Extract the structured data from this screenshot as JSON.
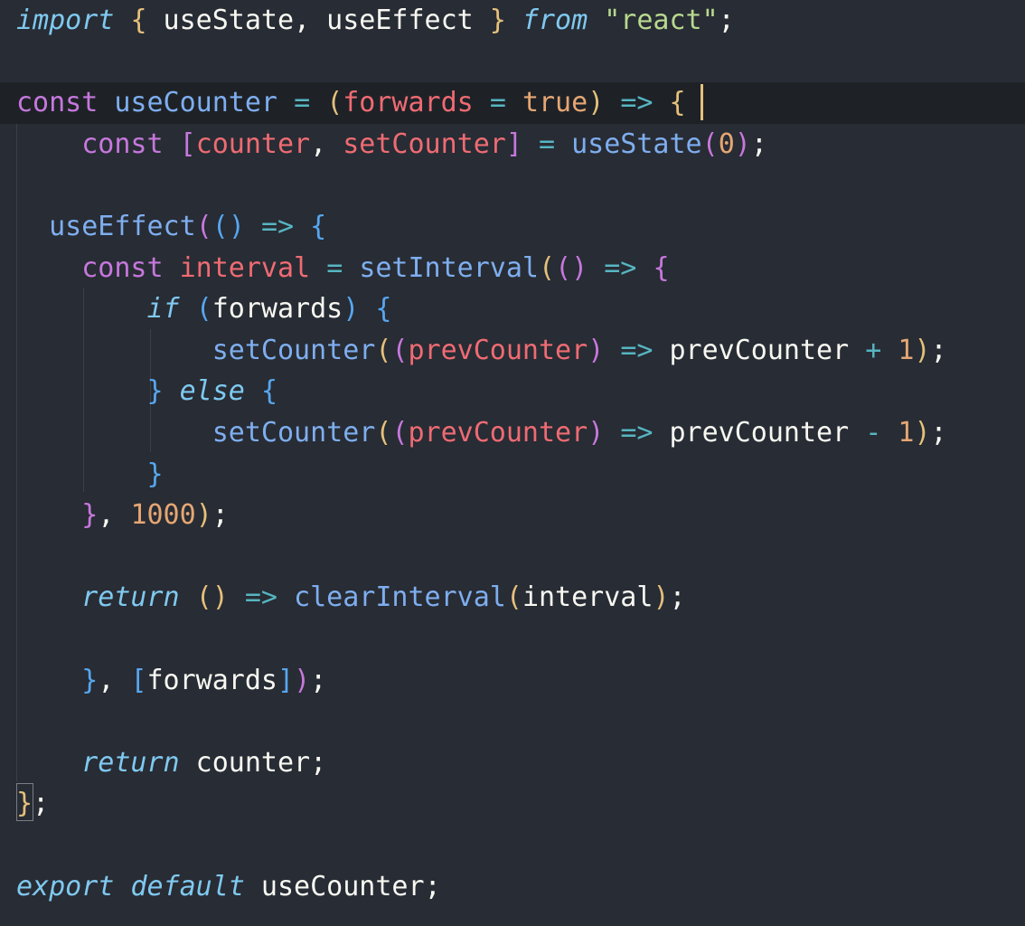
{
  "editor": {
    "language": "javascript",
    "current_line_index": 2,
    "colors": {
      "background": "#282c34",
      "current_line": "#1e2227",
      "keyword": "#c678dd",
      "italic_keyword": "#7fc9f0",
      "function": "#7eaeef",
      "parameter": "#ef6b73",
      "number": "#e5a673",
      "string": "#b8d98f",
      "bracket_level_1": "#e5c07b",
      "bracket_level_2": "#c678dd",
      "bracket_level_3": "#56a7f0"
    },
    "lines": [
      [
        [
          "kwi",
          "import"
        ],
        [
          "pl",
          " "
        ],
        [
          "b1",
          "{"
        ],
        [
          "pl",
          " useState, useEffect "
        ],
        [
          "b1",
          "}"
        ],
        [
          "pl",
          " "
        ],
        [
          "kwi",
          "from"
        ],
        [
          "pl",
          " "
        ],
        [
          "str",
          "\"react\""
        ],
        [
          "sem",
          ";"
        ]
      ],
      [],
      [
        [
          "kw",
          "const"
        ],
        [
          "pl",
          " "
        ],
        [
          "fn",
          "useCounter"
        ],
        [
          "pl",
          " "
        ],
        [
          "op",
          "="
        ],
        [
          "pl",
          " "
        ],
        [
          "b1",
          "("
        ],
        [
          "prm",
          "forwards"
        ],
        [
          "pl",
          " "
        ],
        [
          "op",
          "="
        ],
        [
          "pl",
          " "
        ],
        [
          "num",
          "true"
        ],
        [
          "b1",
          ")"
        ],
        [
          "pl",
          " "
        ],
        [
          "op",
          "=>"
        ],
        [
          "pl",
          " "
        ],
        [
          "b1",
          "{"
        ]
      ],
      [
        [
          "pl",
          "    "
        ],
        [
          "kw",
          "const"
        ],
        [
          "pl",
          " "
        ],
        [
          "b2",
          "["
        ],
        [
          "prm",
          "counter"
        ],
        [
          "pl",
          ", "
        ],
        [
          "prm",
          "setCounter"
        ],
        [
          "b2",
          "]"
        ],
        [
          "pl",
          " "
        ],
        [
          "op",
          "="
        ],
        [
          "pl",
          " "
        ],
        [
          "fn",
          "useState"
        ],
        [
          "b2",
          "("
        ],
        [
          "num",
          "0"
        ],
        [
          "b2",
          ")"
        ],
        [
          "sem",
          ";"
        ]
      ],
      [],
      [
        [
          "pl",
          "  "
        ],
        [
          "fn",
          "useEffect"
        ],
        [
          "b2",
          "("
        ],
        [
          "b3",
          "("
        ],
        [
          "b3",
          ")"
        ],
        [
          "pl",
          " "
        ],
        [
          "op",
          "=>"
        ],
        [
          "pl",
          " "
        ],
        [
          "b3",
          "{"
        ]
      ],
      [
        [
          "pl",
          "    "
        ],
        [
          "kw",
          "const"
        ],
        [
          "pl",
          " "
        ],
        [
          "prm",
          "interval"
        ],
        [
          "pl",
          " "
        ],
        [
          "op",
          "="
        ],
        [
          "pl",
          " "
        ],
        [
          "fn",
          "setInterval"
        ],
        [
          "b1",
          "("
        ],
        [
          "b2",
          "("
        ],
        [
          "b2",
          ")"
        ],
        [
          "pl",
          " "
        ],
        [
          "op",
          "=>"
        ],
        [
          "pl",
          " "
        ],
        [
          "b2",
          "{"
        ]
      ],
      [
        [
          "pl",
          "        "
        ],
        [
          "kwi",
          "if"
        ],
        [
          "pl",
          " "
        ],
        [
          "b3",
          "("
        ],
        [
          "pl",
          "forwards"
        ],
        [
          "b3",
          ")"
        ],
        [
          "pl",
          " "
        ],
        [
          "b3",
          "{"
        ]
      ],
      [
        [
          "pl",
          "            "
        ],
        [
          "fn",
          "setCounter"
        ],
        [
          "b1",
          "("
        ],
        [
          "b2",
          "("
        ],
        [
          "prm",
          "prevCounter"
        ],
        [
          "b2",
          ")"
        ],
        [
          "pl",
          " "
        ],
        [
          "op",
          "=>"
        ],
        [
          "pl",
          " prevCounter "
        ],
        [
          "op",
          "+"
        ],
        [
          "pl",
          " "
        ],
        [
          "num",
          "1"
        ],
        [
          "b1",
          ")"
        ],
        [
          "sem",
          ";"
        ]
      ],
      [
        [
          "pl",
          "        "
        ],
        [
          "b3",
          "}"
        ],
        [
          "pl",
          " "
        ],
        [
          "kwi",
          "else"
        ],
        [
          "pl",
          " "
        ],
        [
          "b3",
          "{"
        ]
      ],
      [
        [
          "pl",
          "            "
        ],
        [
          "fn",
          "setCounter"
        ],
        [
          "b1",
          "("
        ],
        [
          "b2",
          "("
        ],
        [
          "prm",
          "prevCounter"
        ],
        [
          "b2",
          ")"
        ],
        [
          "pl",
          " "
        ],
        [
          "op",
          "=>"
        ],
        [
          "pl",
          " prevCounter "
        ],
        [
          "op",
          "-"
        ],
        [
          "pl",
          " "
        ],
        [
          "num",
          "1"
        ],
        [
          "b1",
          ")"
        ],
        [
          "sem",
          ";"
        ]
      ],
      [
        [
          "pl",
          "        "
        ],
        [
          "b3",
          "}"
        ]
      ],
      [
        [
          "pl",
          "    "
        ],
        [
          "b2",
          "}"
        ],
        [
          "pl",
          ", "
        ],
        [
          "num",
          "1000"
        ],
        [
          "b1",
          ")"
        ],
        [
          "sem",
          ";"
        ]
      ],
      [],
      [
        [
          "pl",
          "    "
        ],
        [
          "kwi",
          "return"
        ],
        [
          "pl",
          " "
        ],
        [
          "b1",
          "("
        ],
        [
          "b1",
          ")"
        ],
        [
          "pl",
          " "
        ],
        [
          "op",
          "=>"
        ],
        [
          "pl",
          " "
        ],
        [
          "fn",
          "clearInterval"
        ],
        [
          "b1",
          "("
        ],
        [
          "pl",
          "interval"
        ],
        [
          "b1",
          ")"
        ],
        [
          "sem",
          ";"
        ]
      ],
      [],
      [
        [
          "pl",
          "    "
        ],
        [
          "b3",
          "}"
        ],
        [
          "pl",
          ", "
        ],
        [
          "b3",
          "["
        ],
        [
          "pl",
          "forwards"
        ],
        [
          "b3",
          "]"
        ],
        [
          "b2",
          ")"
        ],
        [
          "sem",
          ";"
        ]
      ],
      [],
      [
        [
          "pl",
          "    "
        ],
        [
          "kwi",
          "return"
        ],
        [
          "pl",
          " counter"
        ],
        [
          "sem",
          ";"
        ]
      ],
      [
        [
          "b1",
          "}"
        ],
        [
          "sem",
          ";"
        ]
      ],
      [],
      [
        [
          "kwi",
          "export"
        ],
        [
          "pl",
          " "
        ],
        [
          "kwi",
          "default"
        ],
        [
          "pl",
          " useCounter"
        ],
        [
          "sem",
          ";"
        ]
      ]
    ]
  }
}
